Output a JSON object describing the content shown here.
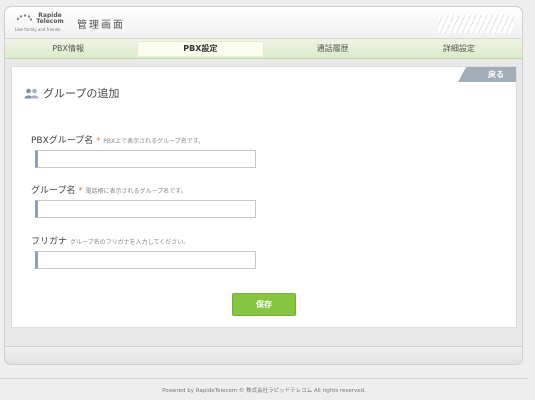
{
  "header": {
    "logo_name": "Rapide Telecom",
    "logo_tagline": "Like family and friends",
    "title": "管理画面"
  },
  "nav": {
    "tabs": [
      {
        "label": "PBX情報",
        "active": false
      },
      {
        "label": "PBX設定",
        "active": true
      },
      {
        "label": "通話履歴",
        "active": false
      },
      {
        "label": "詳細設定",
        "active": false
      }
    ]
  },
  "page": {
    "back_label": "戻る",
    "heading": "グループの追加",
    "heading_icon": "group-icon"
  },
  "form": {
    "pbx_group_name": {
      "label": "PBXグループ名",
      "required_mark": "*",
      "hint": "PBX上で表示されるグループ名です。",
      "value": ""
    },
    "group_name": {
      "label": "グループ名",
      "required_mark": "*",
      "hint": "電話帳に表示されるグループ名です。",
      "value": ""
    },
    "furigana": {
      "label": "フリガナ",
      "hint": "グループ名のフリガナを入力してください。",
      "value": ""
    },
    "save_label": "保存"
  },
  "footer": {
    "text": "Powered by RapideTelecom  © 株式会社ラピッドテレコム All rights reserved."
  },
  "colors": {
    "accent_green": "#87c541",
    "nav_green": "#dcebcb",
    "back_button": "#a3adb8",
    "required": "#e07b1a"
  }
}
